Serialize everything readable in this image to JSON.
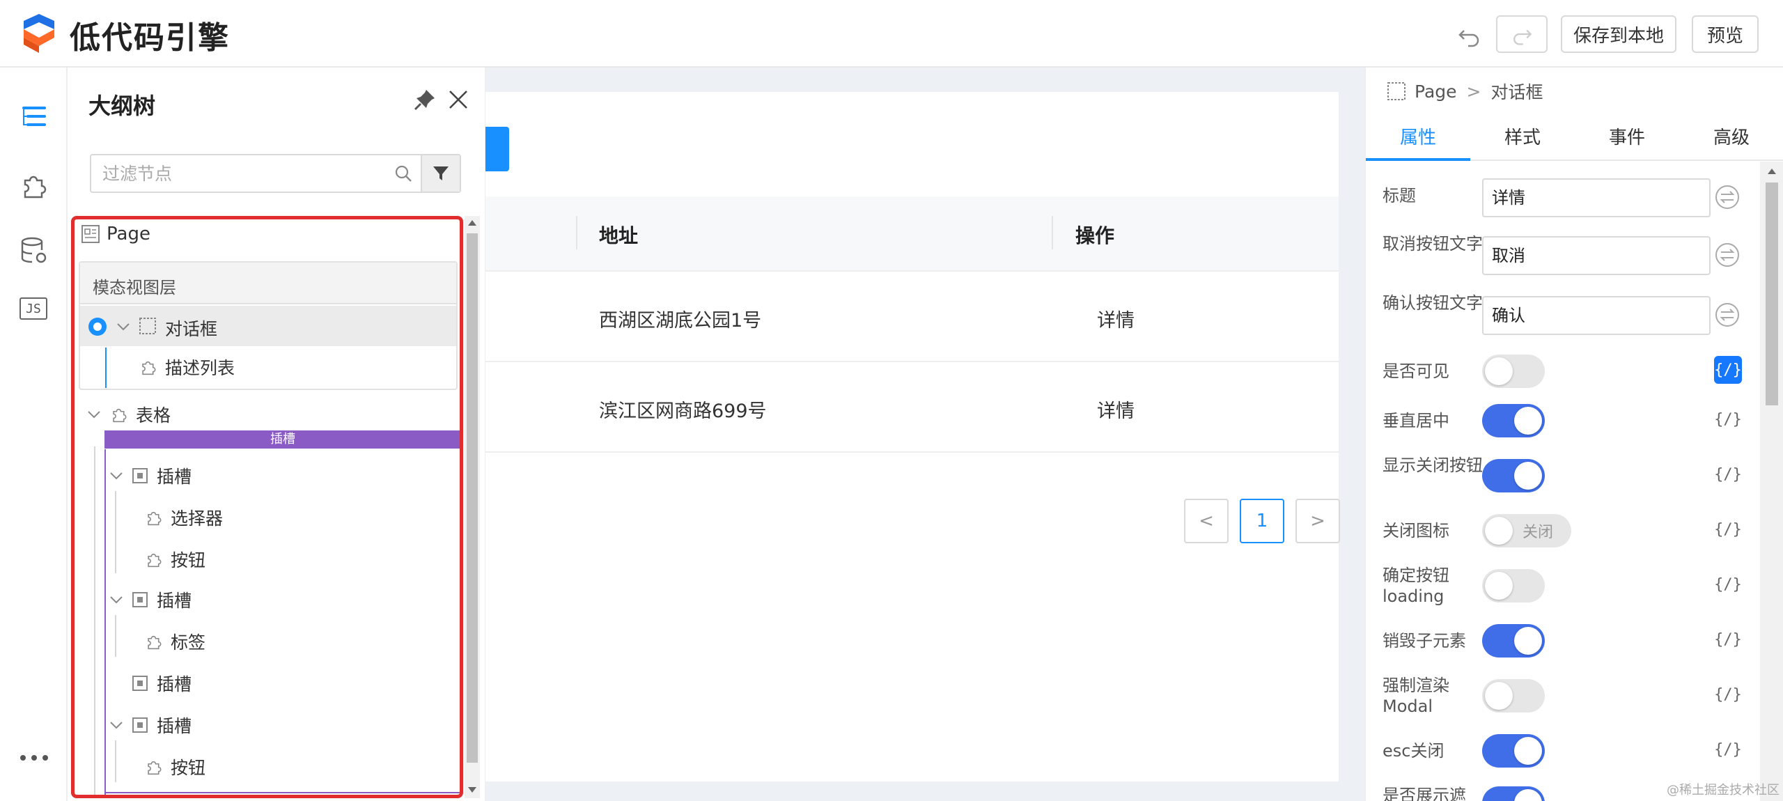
{
  "header": {
    "brand": "低代码引擎",
    "undo_icon": "undo-icon",
    "redo_icon": "redo-icon",
    "save_label": "保存到本地",
    "preview_label": "预览"
  },
  "iconbar": {
    "items": [
      "outline-tree-icon",
      "component-icon",
      "datasource-icon",
      "js-icon"
    ],
    "js_label": "JS",
    "more_icon": "more-icon"
  },
  "outline": {
    "title": "大纲树",
    "filter_placeholder": "过滤节点",
    "nodes": {
      "page": "Page",
      "modal_layer": "模态视图层",
      "dialog": "对话框",
      "desc_list": "描述列表",
      "table": "表格",
      "slot_bar": "插槽",
      "slot1": "插槽",
      "selector": "选择器",
      "button1": "按钮",
      "slot2": "插槽",
      "tag": "标签",
      "slot3": "插槽",
      "slot4": "插槽",
      "button2": "按钮"
    }
  },
  "canvas": {
    "table": {
      "columns": [
        "地址",
        "操作"
      ],
      "rows": [
        {
          "address": "西湖区湖底公园1号",
          "action": "详情"
        },
        {
          "address": "滨江区网商路699号",
          "action": "详情"
        }
      ]
    },
    "pagination": {
      "prev": "<",
      "current": "1",
      "next": ">"
    }
  },
  "rpanel": {
    "breadcrumb": {
      "root": "Page",
      "sep": ">",
      "current": "对话框"
    },
    "tabs": [
      "属性",
      "样式",
      "事件",
      "高级"
    ],
    "active_tab": "属性",
    "props": {
      "title": {
        "label": "标题",
        "value": "详情"
      },
      "cancel_text": {
        "label": "取消按钮文字",
        "value": "取消"
      },
      "ok_text": {
        "label": "确认按钮文字",
        "value": "确认"
      },
      "visible": {
        "label": "是否可见",
        "on": false
      },
      "centered": {
        "label": "垂直居中",
        "on": true
      },
      "closable": {
        "label": "显示关闭按钮",
        "on": true
      },
      "close_icon": {
        "label": "关闭图标",
        "on": false,
        "text": "关闭"
      },
      "ok_loading": {
        "label": "确定按钮loading",
        "on": false
      },
      "destroy": {
        "label": "销毁子元素",
        "on": true
      },
      "force_render": {
        "label": "强制渲染Modal",
        "on": false
      },
      "esc_close": {
        "label": "esc关闭",
        "on": true
      },
      "show_mask": {
        "label": "是否展示遮",
        "on": true
      }
    },
    "code_label": "{/}"
  },
  "watermark": "@稀土掘金技术社区",
  "colors": {
    "primary": "#1890ff",
    "toggle_on": "#3f6ee8",
    "slot_bar": "#8a5bc4",
    "highlight_border": "#e02d2d"
  }
}
